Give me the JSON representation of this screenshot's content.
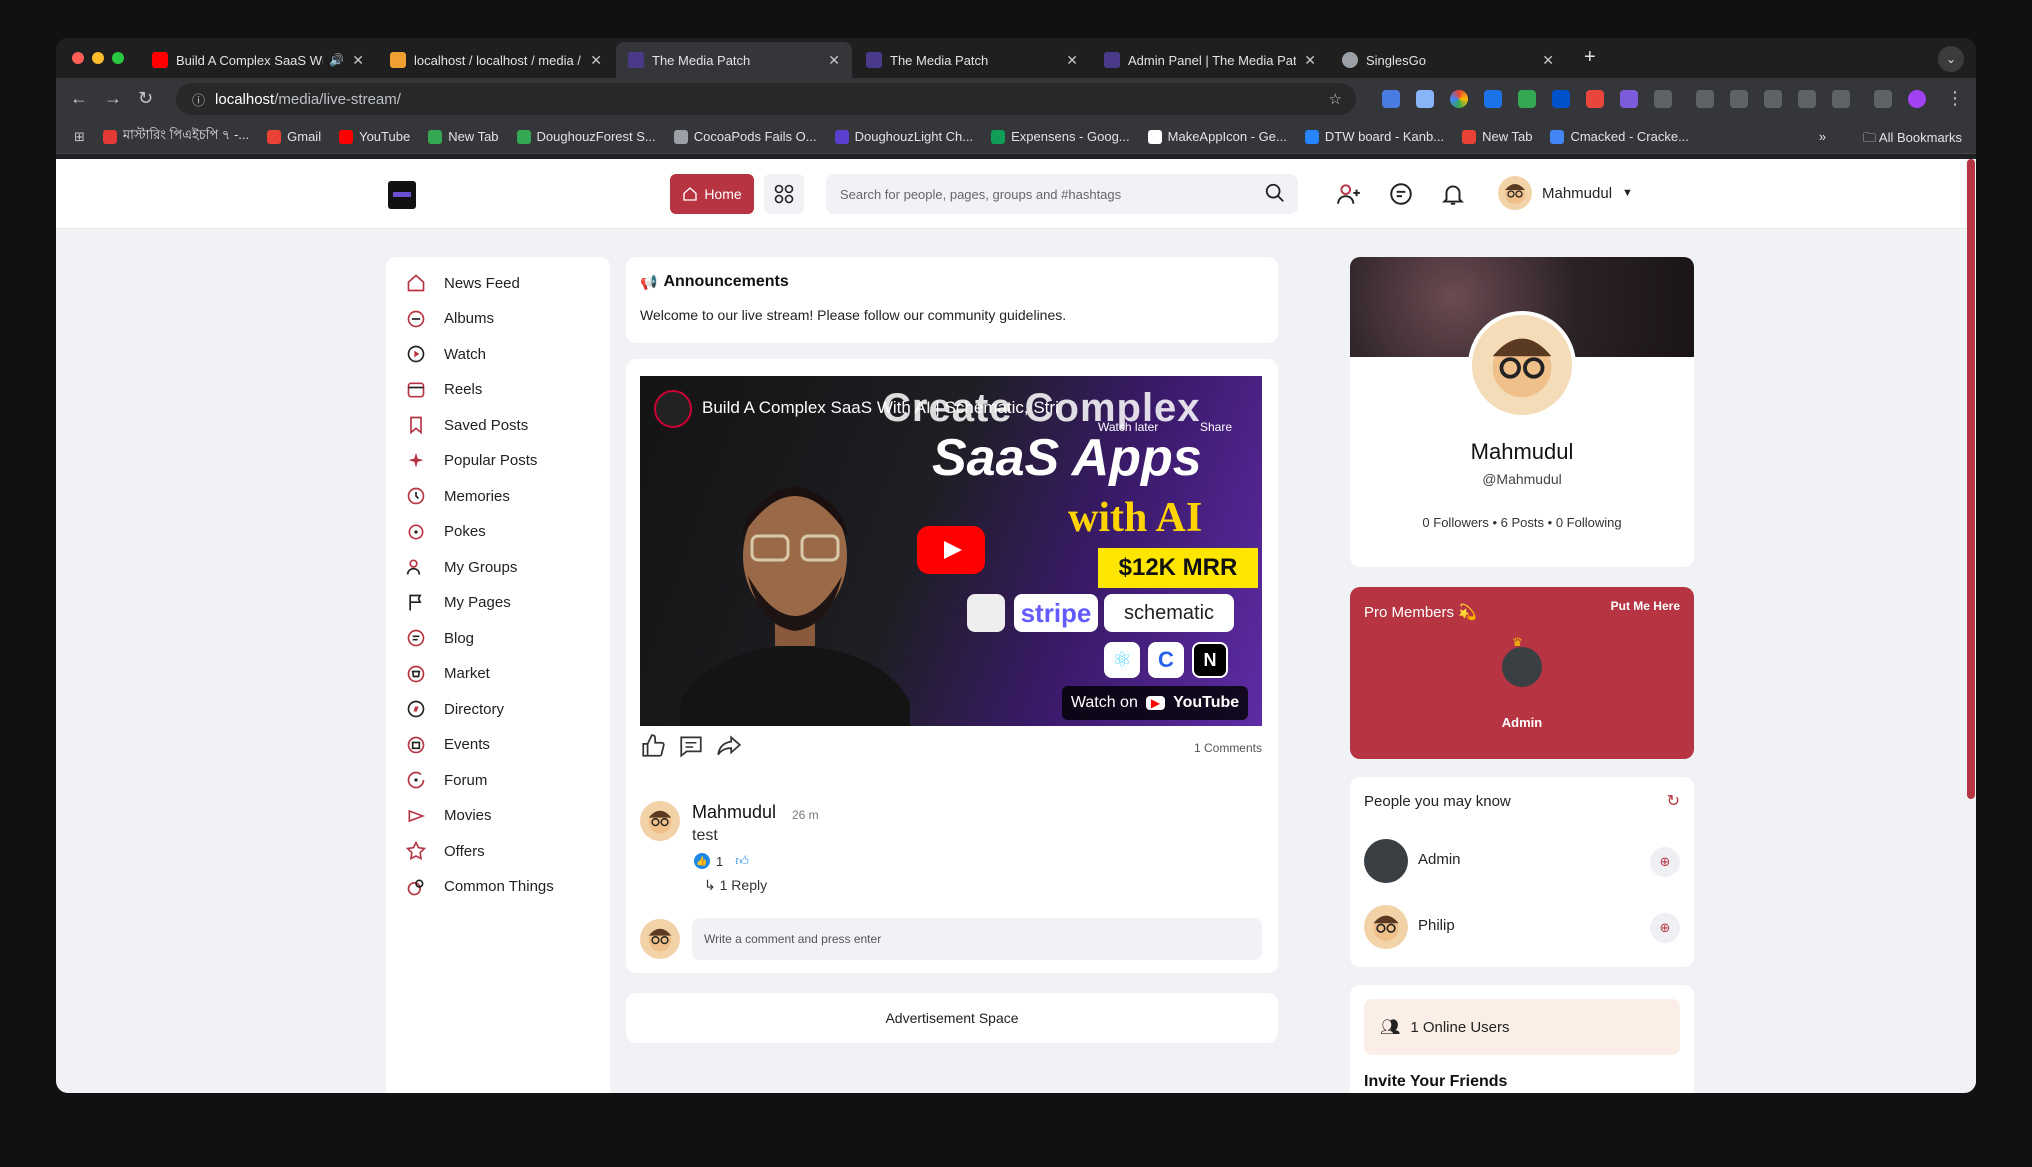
{
  "browser": {
    "tabs": [
      {
        "title": "Build A Complex SaaS Wi",
        "favicon_color": "#ff0000",
        "active": false,
        "audio": true
      },
      {
        "title": "localhost / localhost / media /",
        "favicon_color": "#f0a030",
        "active": false
      },
      {
        "title": "The Media Patch",
        "favicon_color": "#4b3a8c",
        "active": true
      },
      {
        "title": "The Media Patch",
        "favicon_color": "#4b3a8c",
        "active": false
      },
      {
        "title": "Admin Panel | The Media Patc",
        "favicon_color": "#4b3a8c",
        "active": false
      },
      {
        "title": "SinglesGo",
        "favicon_color": "#9aa0a6",
        "active": false
      }
    ],
    "url_host": "localhost",
    "url_path": "/media/live-stream/",
    "bookmarks": [
      {
        "label": "মাস্টারিং পিএইচপি ৭ -...",
        "color": "#e53935"
      },
      {
        "label": "Gmail",
        "color": "#ea4335"
      },
      {
        "label": "YouTube",
        "color": "#ff0000"
      },
      {
        "label": "New Tab",
        "color": "#34a853"
      },
      {
        "label": "DoughouzForest S...",
        "color": "#34a853"
      },
      {
        "label": "CocoaPods Fails O...",
        "color": "#9aa0a6"
      },
      {
        "label": "DoughouzLight Ch...",
        "color": "#5a3fd0"
      },
      {
        "label": "Expensens - Goog...",
        "color": "#0f9d58"
      },
      {
        "label": "MakeAppIcon - Ge...",
        "color": "#ffffff"
      },
      {
        "label": "DTW board - Kanb...",
        "color": "#2684ff"
      },
      {
        "label": "New Tab",
        "color": "#ea4335"
      },
      {
        "label": "Cmacked - Cracke...",
        "color": "#4285f4"
      }
    ],
    "all_bookmarks": "All Bookmarks"
  },
  "header": {
    "home_label": "Home",
    "search_placeholder": "Search for people, pages, groups and #hashtags",
    "user_name": "Mahmudul",
    "accent": "#b73443"
  },
  "sidebar": {
    "items": [
      {
        "label": "News Feed",
        "icon": "home-icon"
      },
      {
        "label": "Albums",
        "icon": "albums-icon"
      },
      {
        "label": "Watch",
        "icon": "watch-icon"
      },
      {
        "label": "Reels",
        "icon": "reels-icon"
      },
      {
        "label": "Saved Posts",
        "icon": "bookmark-icon"
      },
      {
        "label": "Popular Posts",
        "icon": "sparkle-icon"
      },
      {
        "label": "Memories",
        "icon": "memories-icon"
      },
      {
        "label": "Pokes",
        "icon": "poke-icon"
      },
      {
        "label": "My Groups",
        "icon": "groups-icon"
      },
      {
        "label": "My Pages",
        "icon": "flag-icon"
      },
      {
        "label": "Blog",
        "icon": "blog-icon"
      },
      {
        "label": "Market",
        "icon": "market-icon"
      },
      {
        "label": "Directory",
        "icon": "directory-icon"
      },
      {
        "label": "Events",
        "icon": "events-icon"
      },
      {
        "label": "Forum",
        "icon": "forum-icon"
      },
      {
        "label": "Movies",
        "icon": "movies-icon"
      },
      {
        "label": "Offers",
        "icon": "offers-icon"
      },
      {
        "label": "Common Things",
        "icon": "common-things-icon"
      }
    ]
  },
  "announcement": {
    "title": "Announcements",
    "text": "Welcome to our live stream! Please follow our community guidelines."
  },
  "post": {
    "video": {
      "title": "Build A Complex SaaS With AI | Schematic, Stri",
      "watch_later": "Watch later",
      "share": "Share",
      "overlay_line1": "Create Complex",
      "overlay_line2": "SaaS Apps",
      "overlay_line3": "with AI",
      "overlay_badge": "$12K MRR",
      "brand1": "stripe",
      "brand2": "schematic",
      "watch_on": "Watch on",
      "youtube": "YouTube"
    },
    "comments_count": "1 Comments",
    "comment": {
      "author": "Mahmudul",
      "time": "26 m",
      "text": "test",
      "likes": "1",
      "reply_label": "1 Reply"
    },
    "comment_placeholder": "Write a comment and press enter"
  },
  "ad": {
    "label": "Advertisement Space"
  },
  "profile": {
    "name": "Mahmudul",
    "handle": "@Mahmudul",
    "followers": "0 Followers",
    "posts": "6 Posts",
    "following": "0 Following"
  },
  "pro_members": {
    "title": "Pro Members 💫",
    "cta": "Put Me Here",
    "member": "Admin"
  },
  "people": {
    "title": "People you may know",
    "list": [
      {
        "name": "Admin"
      },
      {
        "name": "Philip"
      }
    ]
  },
  "online": {
    "label": "1 Online Users"
  },
  "invite": {
    "title": "Invite Your Friends"
  }
}
